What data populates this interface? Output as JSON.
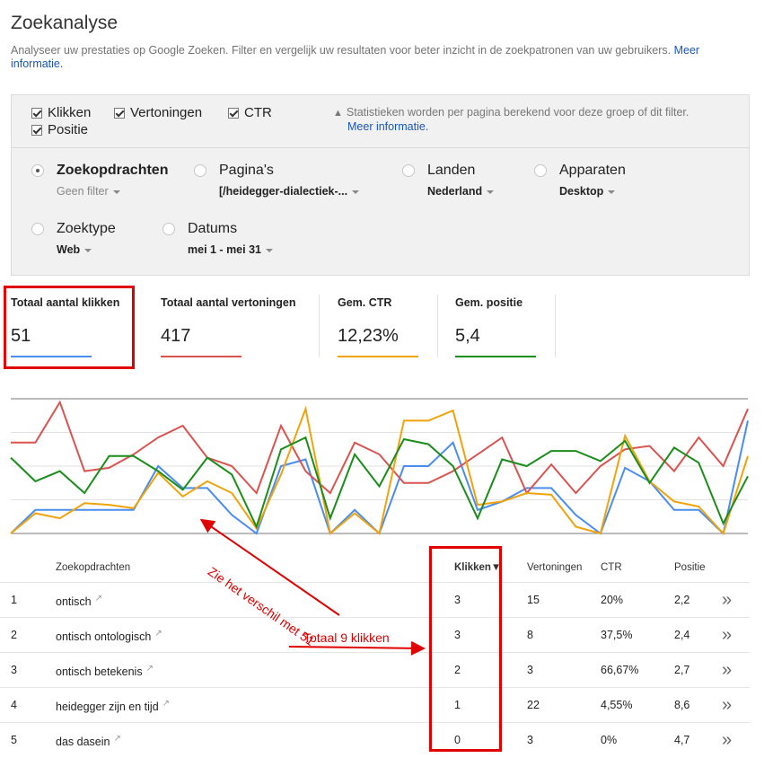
{
  "header": {
    "title": "Zoekanalyse",
    "description": "Analyseer uw prestaties op Google Zoeken. Filter en vergelijk uw resultaten voor beter inzicht in de zoekpatronen van uw gebruikers.",
    "more_link": "Meer informatie."
  },
  "metric_checks": [
    {
      "label": "Klikken",
      "checked": true
    },
    {
      "label": "Vertoningen",
      "checked": true
    },
    {
      "label": "CTR",
      "checked": true
    },
    {
      "label": "Positie",
      "checked": true
    }
  ],
  "notice": {
    "text": "Statistieken worden per pagina berekend voor deze groep of dit filter.",
    "link": "Meer informatie."
  },
  "dimensions": [
    {
      "label": "Zoekopdrachten",
      "value": "Geen filter",
      "selected": true
    },
    {
      "label": "Pagina's",
      "value": "[/heidegger-dialectiek-...",
      "selected": false
    },
    {
      "label": "Landen",
      "value": "Nederland",
      "selected": false
    },
    {
      "label": "Apparaten",
      "value": "Desktop",
      "selected": false
    },
    {
      "label": "Zoektype",
      "value": "Web",
      "selected": false
    },
    {
      "label": "Datums",
      "value": "mei 1 - mei 31",
      "selected": false
    }
  ],
  "summary": [
    {
      "label": "Totaal aantal klikken",
      "value": "51",
      "color": "#4a8df0"
    },
    {
      "label": "Totaal aantal vertoningen",
      "value": "417",
      "color": "#d9534f"
    },
    {
      "label": "Gem. CTR",
      "value": "12,23%",
      "color": "#f0a30a"
    },
    {
      "label": "Gem. positie",
      "value": "5,4",
      "color": "#1a8d1a"
    }
  ],
  "chart_data": {
    "type": "line",
    "x": [
      1,
      2,
      3,
      4,
      5,
      6,
      7,
      8,
      9,
      10,
      11,
      12,
      13,
      14,
      15,
      16,
      17,
      18,
      19,
      20,
      21,
      22,
      23,
      24,
      25,
      26,
      27,
      28,
      29,
      30,
      31
    ],
    "ylim": [
      0,
      4
    ],
    "grid": true,
    "series": [
      {
        "name": "Klikken",
        "color": "#4a8df0",
        "values": [
          0,
          0.7,
          0.7,
          0.7,
          0.7,
          0.7,
          2.0,
          1.35,
          1.35,
          0.55,
          0,
          2.0,
          2.2,
          0,
          0.7,
          0,
          2.0,
          2.0,
          2.7,
          0.7,
          0.95,
          1.35,
          1.35,
          0.55,
          0,
          1.95,
          1.55,
          0.7,
          0.7,
          0,
          3.35
        ]
      },
      {
        "name": "Vertoningen",
        "color": "#d9534f",
        "values": [
          2.7,
          2.7,
          3.9,
          1.85,
          1.95,
          2.35,
          2.85,
          3.2,
          2.25,
          2.0,
          1.2,
          3.2,
          1.85,
          1.2,
          2.7,
          2.35,
          1.5,
          1.5,
          1.85,
          2.35,
          2.85,
          1.2,
          2.05,
          1.2,
          2.0,
          2.5,
          2.6,
          1.85,
          2.85,
          2.0,
          3.7
        ]
      },
      {
        "name": "CTR",
        "color": "#f0a30a",
        "values": [
          0,
          0.6,
          0.45,
          0.9,
          0.85,
          0.75,
          1.8,
          1.1,
          1.55,
          1.2,
          0.15,
          1.75,
          3.7,
          0,
          0.6,
          0,
          3.35,
          3.35,
          3.65,
          0.85,
          0.95,
          1.2,
          1.15,
          0.2,
          0,
          2.9,
          1.55,
          0.95,
          0.8,
          0,
          2.3
        ]
      },
      {
        "name": "Positie",
        "color": "#1a8d1a",
        "values": [
          2.25,
          1.55,
          1.85,
          1.2,
          2.3,
          2.3,
          1.85,
          1.3,
          2.25,
          1.75,
          0.2,
          2.5,
          2.85,
          0.45,
          2.35,
          1.4,
          2.8,
          2.65,
          2.0,
          0.45,
          2.2,
          2.0,
          2.45,
          2.45,
          2.15,
          2.75,
          1.5,
          2.55,
          2.1,
          0.3,
          1.7
        ]
      }
    ]
  },
  "table": {
    "headers": {
      "index": "",
      "query": "Zoekopdrachten",
      "clicks": "Klikken",
      "impressions": "Vertoningen",
      "ctr": "CTR",
      "position": "Positie"
    },
    "rows": [
      {
        "n": "1",
        "query": "ontisch",
        "clicks": "3",
        "impressions": "15",
        "ctr": "20%",
        "position": "2,2"
      },
      {
        "n": "2",
        "query": "ontisch ontologisch",
        "clicks": "3",
        "impressions": "8",
        "ctr": "37,5%",
        "position": "2,4"
      },
      {
        "n": "3",
        "query": "ontisch betekenis",
        "clicks": "2",
        "impressions": "3",
        "ctr": "66,67%",
        "position": "2,7"
      },
      {
        "n": "4",
        "query": "heidegger zijn en tijd",
        "clicks": "1",
        "impressions": "22",
        "ctr": "4,55%",
        "position": "8,6"
      },
      {
        "n": "5",
        "query": "das dasein",
        "clicks": "0",
        "impressions": "3",
        "ctr": "0%",
        "position": "4,7"
      }
    ]
  },
  "annotations": {
    "diff_note": "Zie het verschil met 51",
    "total_note": "Totaal 9 klikken",
    "color": "#e00000"
  }
}
